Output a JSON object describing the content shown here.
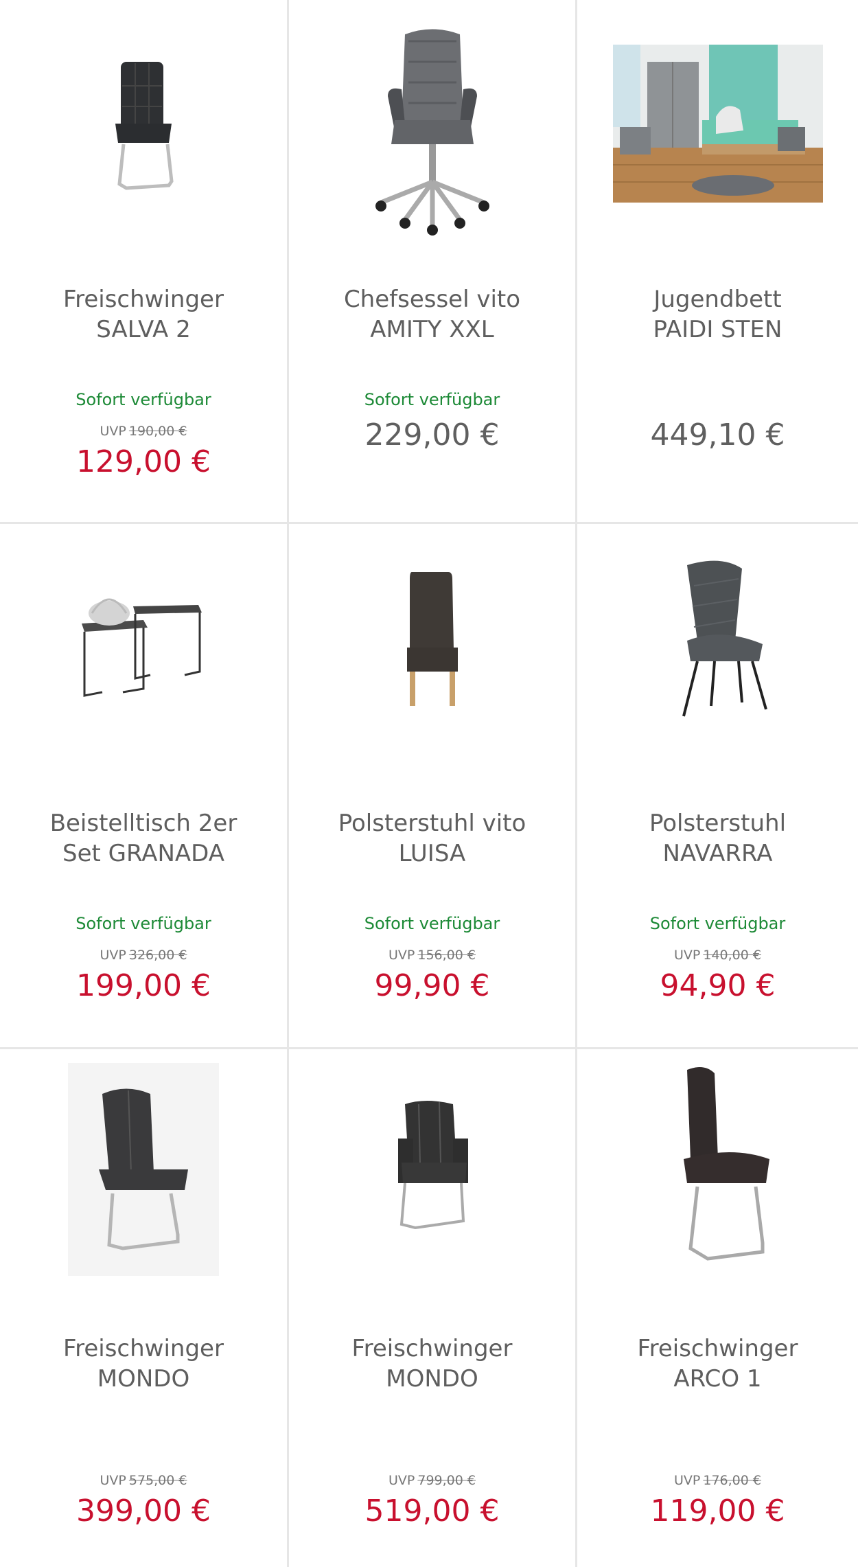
{
  "products": [
    {
      "title_line1": "Freischwinger",
      "title_line2": "SALVA 2",
      "availability": "Sofort verfügbar",
      "uvp_label": "UVP",
      "uvp_old": "190,00 €",
      "price": "129,00 €",
      "icon": "chair-freischwinger-icon"
    },
    {
      "title_line1": "Chefsessel vito",
      "title_line2": "AMITY XXL",
      "availability": "Sofort verfügbar",
      "uvp_label": "",
      "uvp_old": "",
      "price": "229,00 €",
      "icon": "office-chair-icon"
    },
    {
      "title_line1": "Jugendbett",
      "title_line2": "PAIDI STEN",
      "availability": "",
      "uvp_label": "",
      "uvp_old": "",
      "price": "449,10 €",
      "icon": "bed-room-photo"
    },
    {
      "title_line1": "Beistelltisch 2er",
      "title_line2": "Set GRANADA",
      "availability": "Sofort verfügbar",
      "uvp_label": "UVP",
      "uvp_old": "326,00 €",
      "price": "199,00 €",
      "icon": "side-table-icon"
    },
    {
      "title_line1": "Polsterstuhl vito",
      "title_line2": "LUISA",
      "availability": "Sofort verfügbar",
      "uvp_label": "UVP",
      "uvp_old": "156,00 €",
      "price": "99,90 €",
      "icon": "upholstered-chair-icon"
    },
    {
      "title_line1": "Polsterstuhl",
      "title_line2": "NAVARRA",
      "availability": "Sofort verfügbar",
      "uvp_label": "UVP",
      "uvp_old": "140,00 €",
      "price": "94,90 €",
      "icon": "chair-legs-icon"
    },
    {
      "title_line1": "Freischwinger",
      "title_line2": "MONDO",
      "availability": "",
      "uvp_label": "UVP",
      "uvp_old": "575,00 €",
      "price": "399,00 €",
      "icon": "chair-cantilever-icon"
    },
    {
      "title_line1": "Freischwinger",
      "title_line2": "MONDO",
      "availability": "",
      "uvp_label": "UVP",
      "uvp_old": "799,00 €",
      "price": "519,00 €",
      "icon": "armchair-cantilever-icon"
    },
    {
      "title_line1": "Freischwinger",
      "title_line2": "ARCO 1",
      "availability": "",
      "uvp_label": "UVP",
      "uvp_old": "176,00 €",
      "price": "119,00 €",
      "icon": "chair-cantilever-tall-icon"
    }
  ],
  "colors": {
    "sale_price": "#c8102e",
    "availability": "#1d8a37",
    "divider": "#e6e6e6"
  }
}
